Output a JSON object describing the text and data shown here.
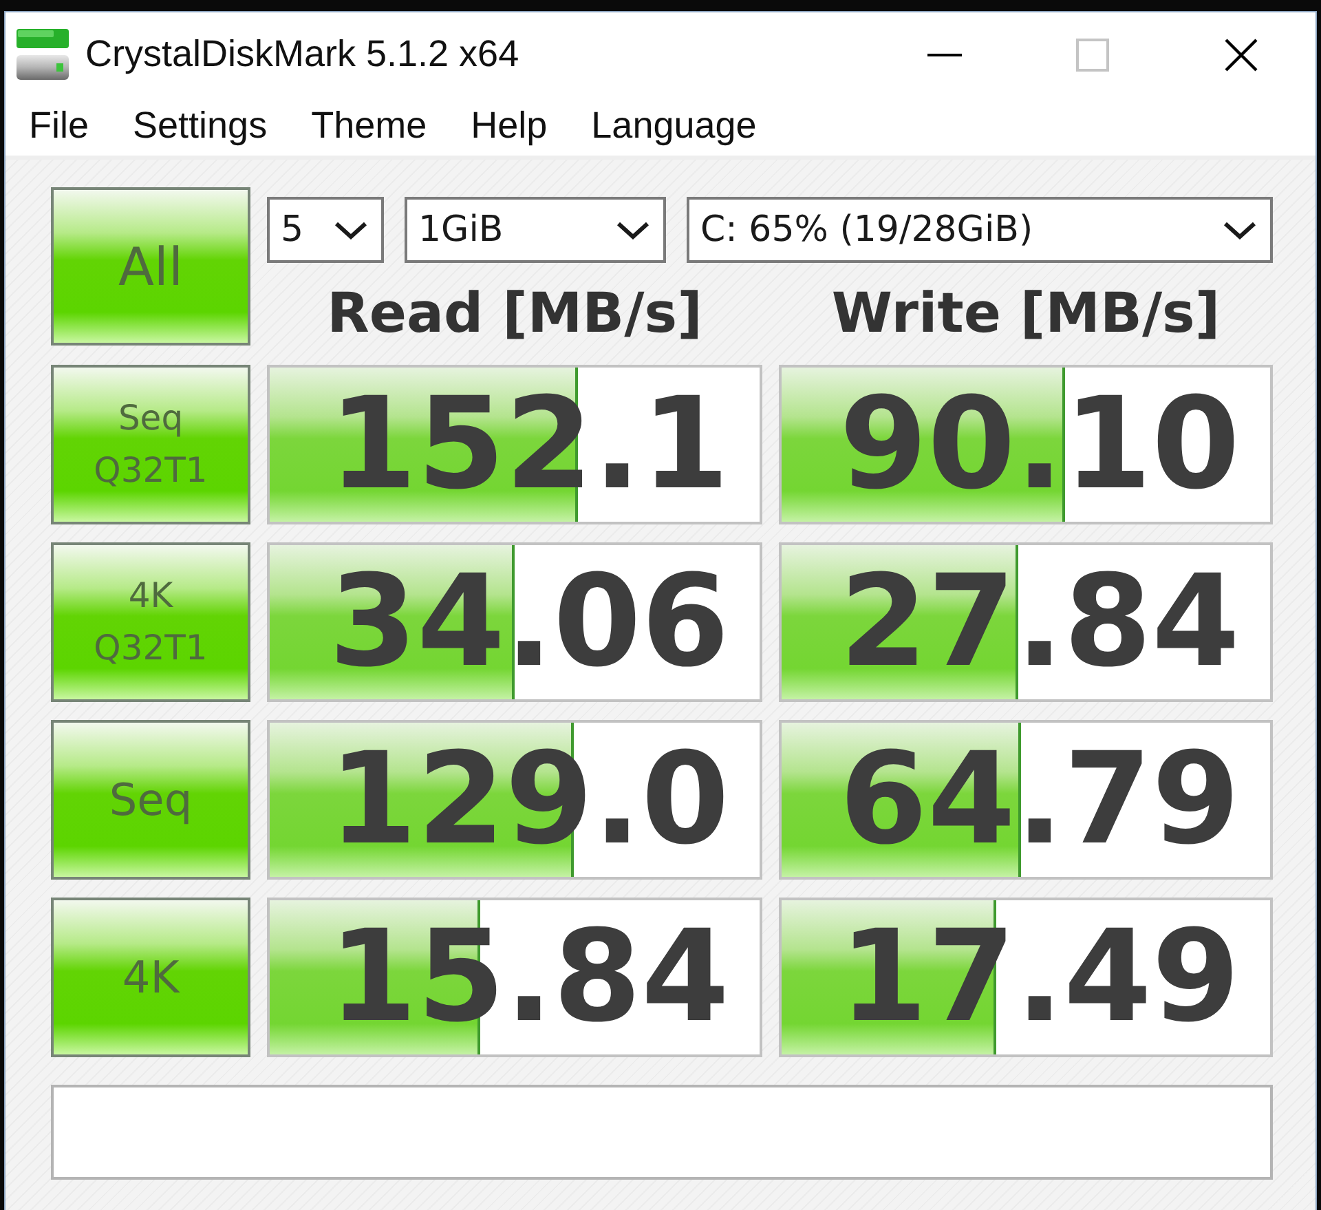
{
  "window": {
    "title": "CrystalDiskMark 5.1.2 x64",
    "maximize_disabled": true
  },
  "menu": [
    "File",
    "Settings",
    "Theme",
    "Help",
    "Language"
  ],
  "all_button": {
    "label": "All"
  },
  "dropdowns": [
    {
      "value": "5"
    },
    {
      "value": "1GiB"
    },
    {
      "value": "C: 65% (19/28GiB)"
    }
  ],
  "columns": [
    "Read [MB/s]",
    "Write [MB/s]"
  ],
  "tests": [
    {
      "label": [
        "Seq",
        "Q32T1"
      ],
      "read": {
        "value": "152.1",
        "level": 0.63
      },
      "write": {
        "value": "90.10",
        "level": 0.58
      }
    },
    {
      "label": [
        "4K",
        "Q32T1"
      ],
      "read": {
        "value": "34.06",
        "level": 0.5
      },
      "write": {
        "value": "27.84",
        "level": 0.485
      }
    },
    {
      "label": [
        "Seq"
      ],
      "read": {
        "value": "129.0",
        "level": 0.62
      },
      "write": {
        "value": "64.79",
        "level": 0.49
      }
    },
    {
      "label": [
        "4K"
      ],
      "read": {
        "value": "15.84",
        "level": 0.43
      },
      "write": {
        "value": "17.49",
        "level": 0.44
      }
    }
  ]
}
